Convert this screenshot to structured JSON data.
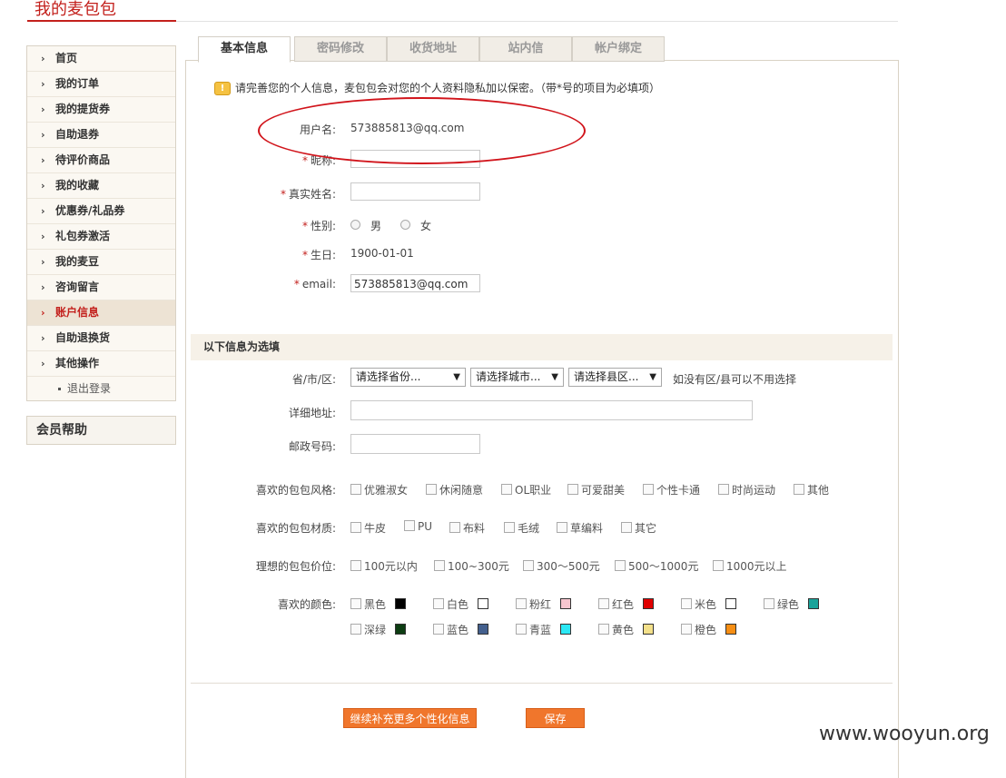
{
  "page": {
    "title": "我的麦包包"
  },
  "sidebar": {
    "items": [
      {
        "label": "首页"
      },
      {
        "label": "我的订单"
      },
      {
        "label": "我的提货券"
      },
      {
        "label": "自助退券"
      },
      {
        "label": "待评价商品"
      },
      {
        "label": "我的收藏"
      },
      {
        "label": "优惠券/礼品券"
      },
      {
        "label": "礼包券激活"
      },
      {
        "label": "我的麦豆"
      },
      {
        "label": "咨询留言"
      },
      {
        "label": "账户信息",
        "active": true
      },
      {
        "label": "自助退换货"
      },
      {
        "label": "其他操作"
      }
    ],
    "sub_item": "退出登录",
    "help_title": "会员帮助"
  },
  "tabs": [
    "基本信息",
    "密码修改",
    "收货地址",
    "站内信",
    "帐户绑定"
  ],
  "notice": "请完善您的个人信息，麦包包会对您的个人资料隐私加以保密。（带*号的项目为必填项）",
  "basic": {
    "username_label": "用户名:",
    "username_value": "573885813@qq.com",
    "required_mark": "*",
    "nickname_label": "昵称:",
    "realname_label": "真实姓名:",
    "gender_label": "性别:",
    "gender_male": "男",
    "gender_female": "女",
    "birthday_label": "生日:",
    "birthday_value": "1900-01-01",
    "email_label": "email:",
    "email_value": "573885813@qq.com"
  },
  "optional": {
    "header": "以下信息为选填",
    "region_label": "省/市/区:",
    "province_selected": "请选择省份...",
    "city_selected": "请选择城市...",
    "county_selected": "请选择县区...",
    "region_hint": "如没有区/县可以不用选择",
    "address_label": "详细地址:",
    "zip_label": "邮政号码:",
    "style_label": "喜欢的包包风格:",
    "styles": [
      "优雅淑女",
      "休闲随意",
      "OL职业",
      "可爱甜美",
      "个性卡通",
      "时尚运动",
      "其他"
    ],
    "material_label": "喜欢的包包材质:",
    "materials": [
      "牛皮",
      "PU",
      "布料",
      "毛绒",
      "草编料",
      "其它"
    ],
    "price_label": "理想的包包价位:",
    "prices": [
      "100元以内",
      "100~300元",
      "300～500元",
      "500～1000元",
      "1000元以上"
    ],
    "color_label": "喜欢的颜色:",
    "colors": [
      {
        "name": "黑色",
        "hex": "#000000"
      },
      {
        "name": "白色",
        "hex": "#ffffff"
      },
      {
        "name": "粉红",
        "hex": "#f7c6cf"
      },
      {
        "name": "红色",
        "hex": "#e00000"
      },
      {
        "name": "米色",
        "hex": "#ffffff"
      },
      {
        "name": "绿色",
        "hex": "#1aa39a"
      },
      {
        "name": "深绿",
        "hex": "#0d3d12"
      },
      {
        "name": "蓝色",
        "hex": "#44608e"
      },
      {
        "name": "青蓝",
        "hex": "#2ce8f5"
      },
      {
        "name": "黄色",
        "hex": "#f3e08a"
      },
      {
        "name": "橙色",
        "hex": "#f68e14"
      }
    ]
  },
  "actions": {
    "more_info": "继续补充更多个性化信息",
    "save": "保存"
  },
  "watermark": "www.wooyun.org"
}
